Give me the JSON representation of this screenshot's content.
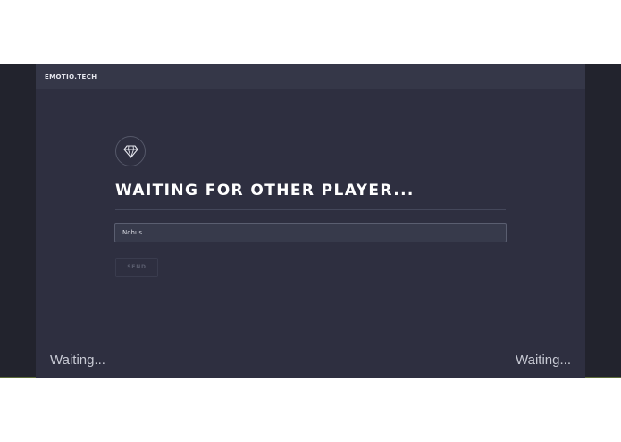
{
  "header": {
    "brand": "EMOTIO.TECH"
  },
  "main": {
    "icon": "diamond-icon",
    "title": "WAITING FOR OTHER PLAYER...",
    "name_input_value": "Nohus",
    "send_label": "SEND"
  },
  "footer": {
    "left_status": "Waiting...",
    "right_status": "Waiting..."
  },
  "colors": {
    "background": "#2e2f40",
    "topbar": "#353748",
    "outer": "#22232d",
    "text": "#ffffff"
  }
}
